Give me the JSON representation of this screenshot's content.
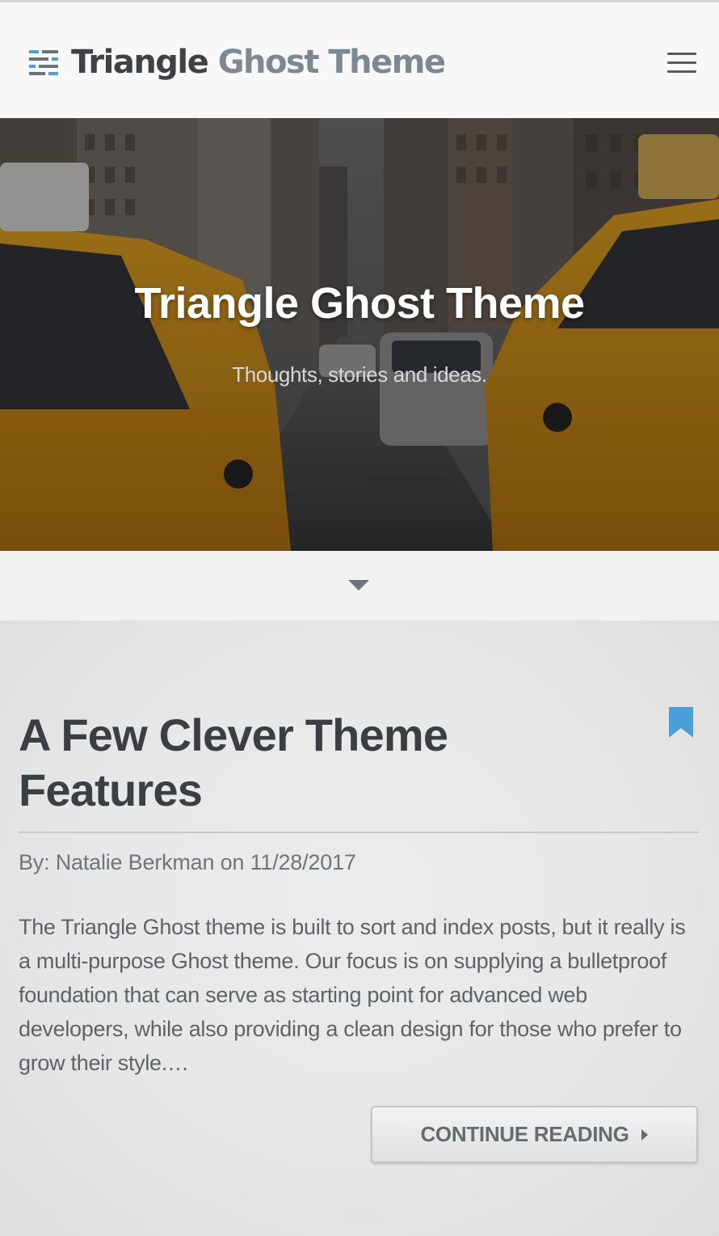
{
  "header": {
    "logo_word1": "Triangle",
    "logo_word2": "Ghost Theme",
    "logo_icon": "stacked-lines-logo-icon",
    "menu_icon": "hamburger-menu-icon"
  },
  "hero": {
    "title": "Triangle Ghost Theme",
    "subtitle": "Thoughts, stories and ideas."
  },
  "scroll": {
    "icon": "chevron-down-icon"
  },
  "post": {
    "title": "A Few Clever Theme Features",
    "byline_prefix": "By: ",
    "author": "Natalie Berkman",
    "byline_on": " on ",
    "date": "11/28/2017",
    "excerpt": "The Triangle Ghost theme is built to sort and index posts, but it really is a multi-purpose Ghost theme. Our focus is on supplying a bulletproof foundation that can serve as starting point for advanced web developers, while also providing a clean design for those who prefer to grow their style.…",
    "continue_label": "CONTINUE READING",
    "bookmark_icon": "bookmark-icon"
  },
  "colors": {
    "accent_blue": "#4a9fd8",
    "text_dark": "#3a3f44",
    "text_muted": "#6f757a"
  }
}
